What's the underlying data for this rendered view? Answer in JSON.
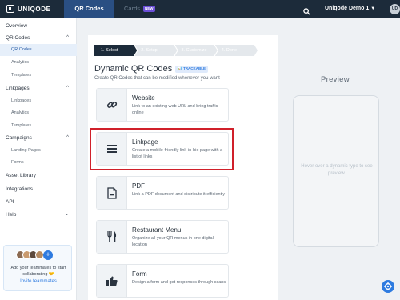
{
  "topbar": {
    "brand": "UNIQODE",
    "tabs": [
      {
        "label": "QR Codes",
        "active": true
      },
      {
        "label": "Cards",
        "badge": "NEW",
        "active": false
      }
    ],
    "account": "Uniqode Demo 1",
    "avatar_initials": "UD"
  },
  "sidebar": {
    "items": [
      {
        "label": "Overview",
        "level": 0
      },
      {
        "label": "QR Codes",
        "level": 0,
        "expanded": true
      },
      {
        "label": "QR Codes",
        "level": 1,
        "active": true
      },
      {
        "label": "Analytics",
        "level": 1
      },
      {
        "label": "Templates",
        "level": 1
      },
      {
        "label": "Linkpages",
        "level": 0,
        "expanded": true
      },
      {
        "label": "Linkpages",
        "level": 1
      },
      {
        "label": "Analytics",
        "level": 1
      },
      {
        "label": "Templates",
        "level": 1
      },
      {
        "label": "Campaigns",
        "level": 0,
        "expanded": true
      },
      {
        "label": "Landing Pages",
        "level": 1
      },
      {
        "label": "Forms",
        "level": 1
      },
      {
        "label": "Asset Library",
        "level": 0
      },
      {
        "label": "Integrations",
        "level": 0
      },
      {
        "label": "API",
        "level": 0
      },
      {
        "label": "Help",
        "level": 0
      }
    ],
    "invite": {
      "text": "Add your teammates to start collaborating 🤝",
      "link": "Invite teammates"
    }
  },
  "stepper": [
    "1. Select",
    "2. Setup",
    "3. Customize",
    "4. Done"
  ],
  "main": {
    "title": "Dynamic QR Codes",
    "badge": "TRACKABLE",
    "subtitle": "Create QR Codes that can be modified whenever you want",
    "cards": [
      {
        "title": "Website",
        "desc": "Link to an existing web URL and bring traffic online",
        "icon": "link-icon"
      },
      {
        "title": "Linkpage",
        "desc": "Create a mobile-friendly link-in-bio page with a list of links",
        "icon": "list-icon",
        "highlighted": true
      },
      {
        "title": "PDF",
        "desc": "Link a PDF document and distribute it efficiently",
        "icon": "pdf-icon"
      },
      {
        "title": "Restaurant Menu",
        "desc": "Organize all your QR menus in one digital location",
        "icon": "fork-knife-icon"
      },
      {
        "title": "Form",
        "desc": "Design a form and get responses through scans",
        "icon": "thumbs-up-icon"
      }
    ]
  },
  "preview": {
    "title": "Preview",
    "hint": "Hover over a dynamic type to see preview."
  },
  "colors": {
    "topbar": "#1c2b3a",
    "active_tab": "#2a4f83",
    "accent": "#2e7be0",
    "highlight": "#d0202a"
  }
}
